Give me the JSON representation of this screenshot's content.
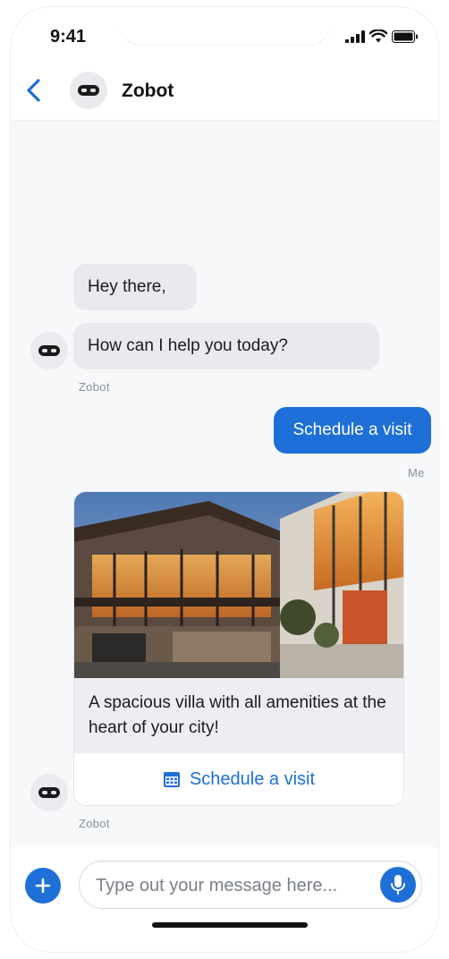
{
  "status_bar": {
    "time": "9:41"
  },
  "header": {
    "title": "Zobot"
  },
  "messages": {
    "bot_1": "Hey there,",
    "bot_2": "How can I help you today?",
    "bot_2_sender": "Zobot",
    "user_1": "Schedule a visit",
    "user_1_sender": "Me",
    "card_description": "A spacious villa with all amenities at the heart of your city!",
    "card_button_label": "Schedule a visit",
    "card_sender": "Zobot"
  },
  "composer": {
    "placeholder": "Type out your message here..."
  },
  "icons": {
    "back": "chevron-left-icon",
    "bot": "robot-mask-icon",
    "add": "plus-icon",
    "calendar": "calendar-icon",
    "mic": "microphone-icon"
  },
  "colors": {
    "accent": "#1e6fd8",
    "bot_bubble": "#e8eaee",
    "chat_background": "#f7f8fa"
  }
}
